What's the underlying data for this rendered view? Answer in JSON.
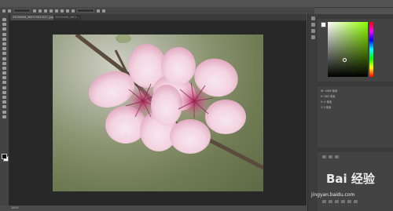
{
  "colors": {
    "accent": "#8fff00",
    "canvas_bg": "#282828",
    "ui_bg": "#535353"
  },
  "document": {
    "tab_active": "20190406_085719421317_jpg @ 100%(RGB/8#)",
    "tab_inactive": "20190406_0851..."
  },
  "status": {
    "zoom": "100%"
  },
  "properties_panel": {
    "row1": "W: 1086 像素",
    "row2": "H: 885 像素",
    "row3": "X: 0 像素",
    "row4": "Y: 0 像素"
  },
  "watermark": {
    "brand": "Bai 经验",
    "url": "jingyan.baidu.com"
  }
}
